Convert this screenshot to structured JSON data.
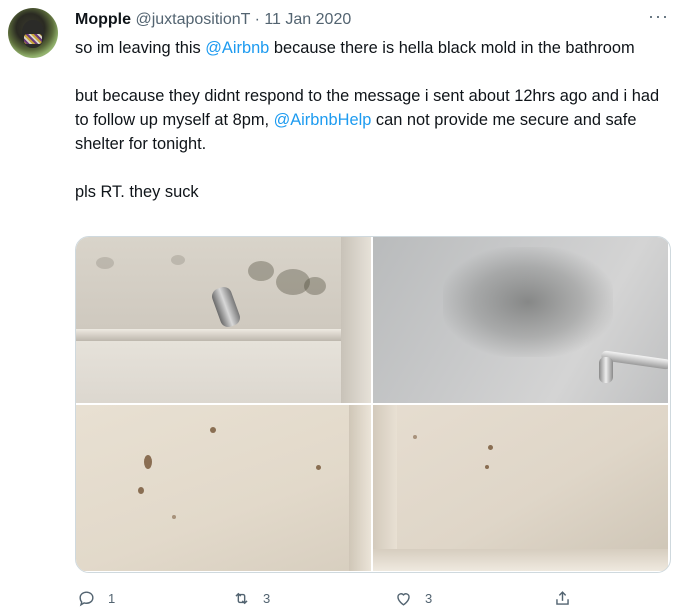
{
  "tweet": {
    "display_name": "Mopple",
    "handle": "@juxtapositionT",
    "separator": " · ",
    "date": "11 Jan 2020",
    "more_label": "···",
    "text": {
      "p1_a": "so im leaving this ",
      "p1_link": "@Airbnb",
      "p1_b": " because there is hella black mold in the bathroom",
      "p2_a": "but because they didnt respond to the message i sent about 12hrs ago and i had to follow up myself at 8pm,  ",
      "p2_link": "@AirbnbHelp",
      "p2_b": " can not provide me secure and safe shelter for tonight.",
      "p3": "pls RT. they suck"
    },
    "media": [
      {
        "description": "shower-head-wall-mold"
      },
      {
        "description": "black-mold-on-wall"
      },
      {
        "description": "mold-spots-on-ceiling"
      },
      {
        "description": "mold-spots-on-wall-corner"
      }
    ],
    "actions": {
      "reply_icon": "reply-icon",
      "reply_count": "1",
      "retweet_icon": "retweet-icon",
      "retweet_count": "3",
      "like_icon": "heart-icon",
      "like_count": "3",
      "share_icon": "share-icon"
    }
  },
  "colors": {
    "link": "#1d9bf0",
    "secondary_text": "#536471",
    "primary_text": "#0f1419",
    "border": "#cfd9de"
  }
}
